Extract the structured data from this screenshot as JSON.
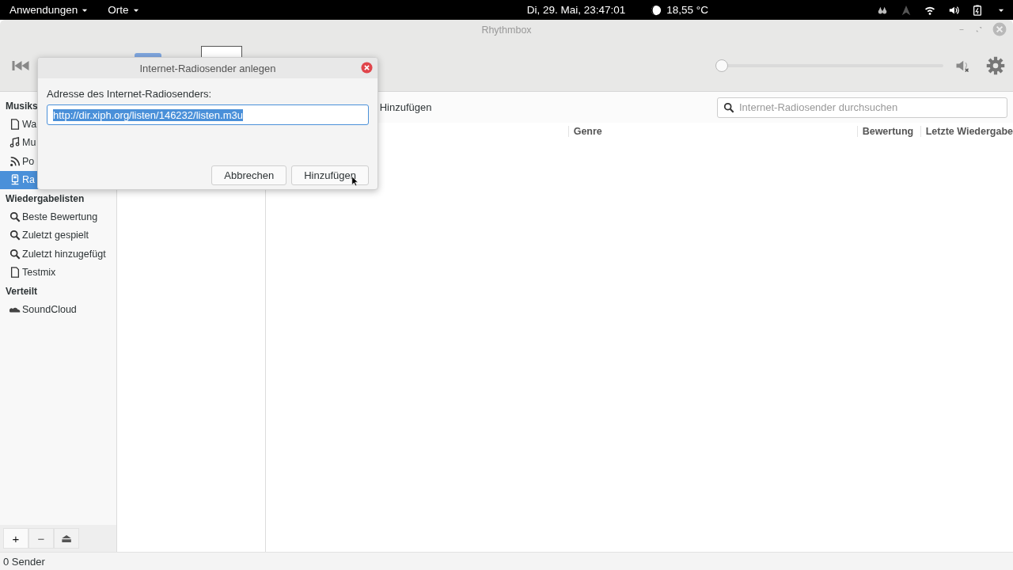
{
  "top_bar": {
    "menus": [
      {
        "label": "Anwendungen"
      },
      {
        "label": "Orte"
      }
    ],
    "clock": "Di, 29. Mai, 23:47:01",
    "weather": "18,55 °C"
  },
  "window": {
    "title": "Rhythmbox"
  },
  "player": {
    "seek": {
      "level": 0
    },
    "muted": true
  },
  "sidebar": {
    "sections": [
      {
        "title": "Musiks",
        "items": [
          {
            "label": "Wa",
            "kind": "file",
            "selected": false
          },
          {
            "label": "Mu",
            "kind": "music",
            "selected": false
          },
          {
            "label": "Po",
            "kind": "feed",
            "selected": false
          },
          {
            "label": "Ra",
            "kind": "radio",
            "selected": true
          }
        ]
      },
      {
        "title": "Wiedergabelisten",
        "items": [
          {
            "label": "Beste Bewertung",
            "kind": "search",
            "selected": false
          },
          {
            "label": "Zuletzt gespielt",
            "kind": "search",
            "selected": false
          },
          {
            "label": "Zuletzt hinzugefügt",
            "kind": "search",
            "selected": false
          },
          {
            "label": "Testmix",
            "kind": "file",
            "selected": false
          }
        ]
      },
      {
        "title": "Verteilt",
        "items": [
          {
            "label": "SoundCloud",
            "kind": "cloud",
            "selected": false
          }
        ]
      }
    ],
    "buttons": [
      "+",
      "−",
      "⏏"
    ]
  },
  "toolbar": {
    "add_button": "Hinzufügen",
    "search": {
      "placeholder": "Internet-Radiosender durchsuchen"
    }
  },
  "table": {
    "columns": [
      "Genre",
      "Bewertung",
      "Letzte Wiedergabe"
    ]
  },
  "status_bar": "0 Sender",
  "dialog": {
    "title": "Internet-Radiosender anlegen",
    "label": "Adresse des Internet-Radiosenders:",
    "url": "http://dir.xiph.org/listen/146232/listen.m3u",
    "buttons": [
      "Abbrechen",
      "Hinzufügen"
    ]
  }
}
